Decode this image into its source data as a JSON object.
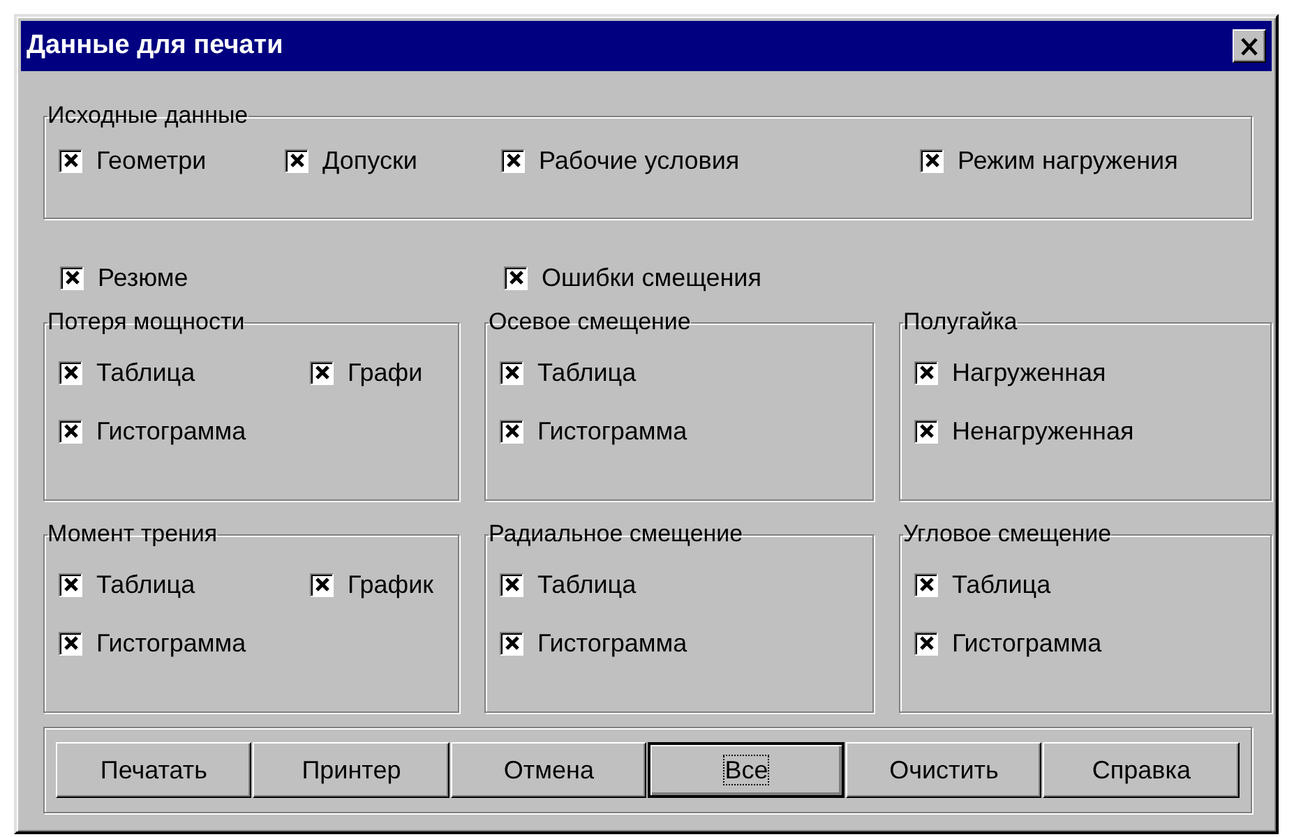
{
  "window": {
    "title": "Данные для печати"
  },
  "source_group": {
    "label": "Исходные данные",
    "items": [
      {
        "label": "Геометри",
        "checked": true
      },
      {
        "label": "Допуски",
        "checked": true
      },
      {
        "label": "Рабочие условия",
        "checked": true
      },
      {
        "label": "Режим нагружения",
        "checked": true
      }
    ]
  },
  "options": [
    {
      "label": "Резюме",
      "checked": true
    },
    {
      "label": "Ошибки смещения",
      "checked": true
    }
  ],
  "groups": [
    {
      "label": "Потеря мощности",
      "items": [
        {
          "label": "Таблица",
          "checked": true
        },
        {
          "label": "Графи",
          "checked": true
        },
        {
          "label": "Гистограмма",
          "checked": true
        }
      ]
    },
    {
      "label": "Осевое смещение",
      "items": [
        {
          "label": "Таблица",
          "checked": true
        },
        {
          "label": "Гистограмма",
          "checked": true
        }
      ]
    },
    {
      "label": "Полугайка",
      "items": [
        {
          "label": "Нагруженная",
          "checked": true
        },
        {
          "label": "Ненагруженная",
          "checked": true
        }
      ]
    },
    {
      "label": "Момент трения",
      "items": [
        {
          "label": "Таблица",
          "checked": true
        },
        {
          "label": "График",
          "checked": true
        },
        {
          "label": "Гистограмма",
          "checked": true
        }
      ]
    },
    {
      "label": "Радиальное смещение",
      "items": [
        {
          "label": "Таблица",
          "checked": true
        },
        {
          "label": "Гистограмма",
          "checked": true
        }
      ]
    },
    {
      "label": "Угловое смещение",
      "items": [
        {
          "label": "Таблица",
          "checked": true
        },
        {
          "label": "Гистограмма",
          "checked": true
        }
      ]
    }
  ],
  "buttons": [
    {
      "label": "Печатать",
      "focused": false
    },
    {
      "label": "Принтер",
      "focused": false
    },
    {
      "label": "Отмена",
      "focused": false
    },
    {
      "label": "Все",
      "focused": true
    },
    {
      "label": "Очистить",
      "focused": false
    },
    {
      "label": "Справка",
      "focused": false
    }
  ]
}
